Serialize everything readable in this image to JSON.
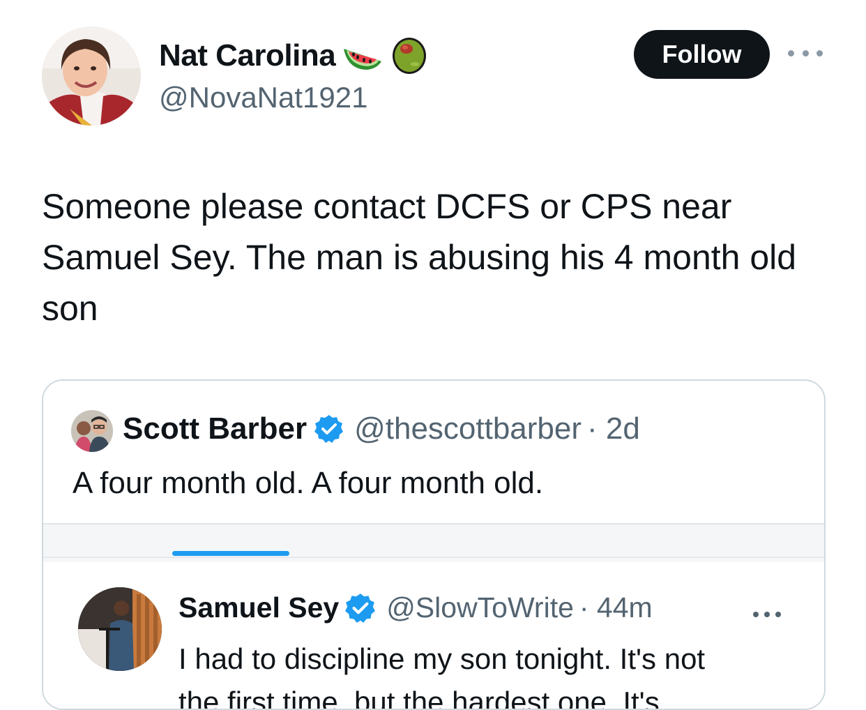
{
  "post": {
    "author_name": "Nat Carolina",
    "author_handle": "@NovaNat1921",
    "badges": [
      "watermelon-icon",
      "olive-icon"
    ],
    "follow_label": "Follow",
    "text": "Someone please contact DCFS or CPS near Samuel Sey. The man is abusing his 4 month old son"
  },
  "quoted": {
    "author_name": "Scott Barber",
    "author_handle": "@thescottbarber",
    "time": "· 2d",
    "text": "A four month old. A four month old.",
    "embedded": {
      "author_name": "Samuel Sey",
      "author_handle": "@SlowToWrite",
      "time": "· 44m",
      "text": "I had to discipline my son tonight. It's not",
      "text_cut": "the first time, but the hardest one. It's"
    }
  },
  "colors": {
    "text": "#0f1419",
    "secondary": "#536471",
    "border": "#cfd9de",
    "accent": "#1d9bf0",
    "follow_bg": "#0f1419"
  }
}
